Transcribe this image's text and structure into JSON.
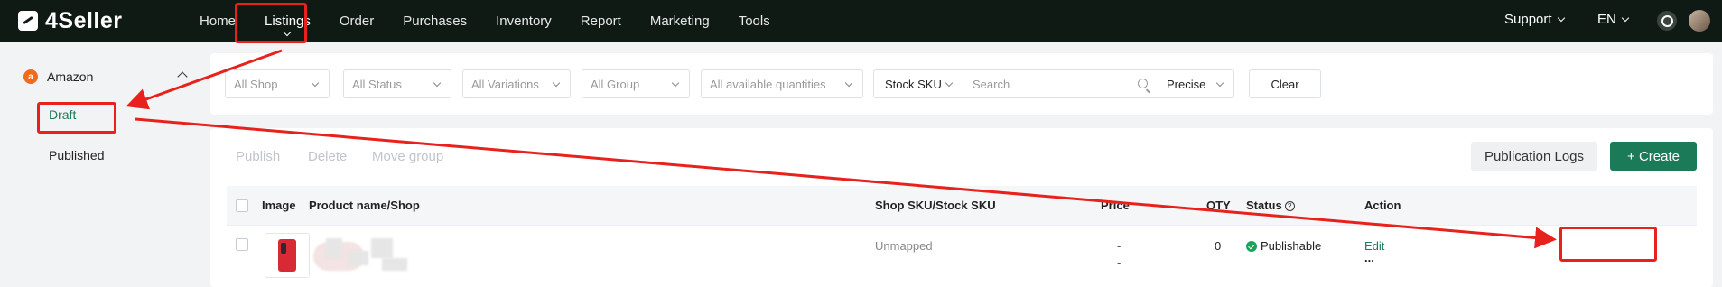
{
  "app": {
    "logo_text": "4Seller"
  },
  "nav": {
    "items": [
      {
        "label": "Home"
      },
      {
        "label": "Listings",
        "active": true
      },
      {
        "label": "Order"
      },
      {
        "label": "Purchases"
      },
      {
        "label": "Inventory"
      },
      {
        "label": "Report"
      },
      {
        "label": "Marketing"
      },
      {
        "label": "Tools"
      }
    ],
    "support_label": "Support",
    "lang_label": "EN"
  },
  "sidebar": {
    "platform_label": "Amazon",
    "platform_icon_text": "a",
    "items": [
      {
        "label": "Draft",
        "active": true
      },
      {
        "label": "Published"
      }
    ]
  },
  "filters": {
    "shop": "All Shop",
    "status": "All Status",
    "variations": "All Variations",
    "group": "All Group",
    "quantities": "All available quantities",
    "search_field": "Stock SKU",
    "search_placeholder": "Search",
    "match_mode": "Precise",
    "clear_label": "Clear"
  },
  "toolbar": {
    "publish_label": "Publish",
    "delete_label": "Delete",
    "move_group_label": "Move group",
    "publication_logs_label": "Publication Logs",
    "create_label": "+ Create"
  },
  "table": {
    "headers": {
      "image": "Image",
      "product": "Product name/Shop",
      "sku": "Shop SKU/Stock SKU",
      "price": "Price",
      "qty": "QTY",
      "status": "Status",
      "action": "Action"
    },
    "rows": [
      {
        "sku": "Unmapped",
        "price_1": "-",
        "price_2": "-",
        "qty": "0",
        "status": "Publishable",
        "action_edit": "Edit",
        "action_more": "..."
      }
    ]
  },
  "colors": {
    "topbar_bg": "#0f1a14",
    "accent": "#1b7a58",
    "annotation": "#e8211c",
    "status_ok": "#1aa35a"
  }
}
